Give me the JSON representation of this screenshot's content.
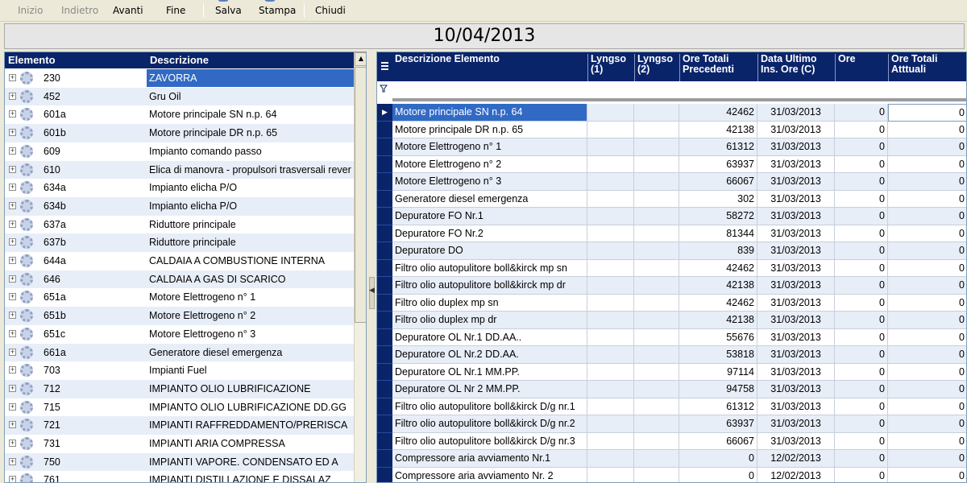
{
  "toolbar": {
    "items": [
      {
        "label": "Inizio",
        "enabled": false
      },
      {
        "label": "Indietro",
        "enabled": false
      },
      {
        "label": "Avanti",
        "enabled": true
      },
      {
        "label": "Fine",
        "enabled": true
      },
      {
        "label": "Salva",
        "enabled": true
      },
      {
        "label": "Stampa",
        "enabled": true
      },
      {
        "label": "Chiudi",
        "enabled": true
      }
    ]
  },
  "date_display": "10/04/2013",
  "left_grid": {
    "columns": [
      "Elemento",
      "Descrizione"
    ],
    "selected_index": 0,
    "rows": [
      {
        "code": "230",
        "desc": "ZAVORRA"
      },
      {
        "code": "452",
        "desc": "Gru Oil"
      },
      {
        "code": "601a",
        "desc": "Motore principale SN n.p. 64"
      },
      {
        "code": "601b",
        "desc": "Motore principale DR n.p. 65"
      },
      {
        "code": "609",
        "desc": "Impianto comando passo"
      },
      {
        "code": "610",
        "desc": "Elica di manovra - propulsori trasversali rever"
      },
      {
        "code": "634a",
        "desc": "Impianto elicha P/O"
      },
      {
        "code": "634b",
        "desc": "Impianto elicha P/O"
      },
      {
        "code": "637a",
        "desc": "Riduttore principale"
      },
      {
        "code": "637b",
        "desc": "Riduttore principale"
      },
      {
        "code": "644a",
        "desc": "CALDAIA A  COMBUSTIONE  INTERNA"
      },
      {
        "code": "646",
        "desc": "CALDAIA  A  GAS   DI  SCARICO"
      },
      {
        "code": "651a",
        "desc": "Motore Elettrogeno n° 1"
      },
      {
        "code": "651b",
        "desc": "Motore Elettrogeno n° 2"
      },
      {
        "code": "651c",
        "desc": "Motore Elettrogeno n° 3"
      },
      {
        "code": "661a",
        "desc": "Generatore diesel emergenza"
      },
      {
        "code": "703",
        "desc": "Impianti Fuel"
      },
      {
        "code": "712",
        "desc": "IMPIANTO OLIO LUBRIFICAZIONE"
      },
      {
        "code": "715",
        "desc": "IMPIANTO OLIO LUBRIFICAZIONE DD.GG"
      },
      {
        "code": "721",
        "desc": "IMPIANTI RAFFREDDAMENTO/PRERISCA"
      },
      {
        "code": "731",
        "desc": "IMPIANTI ARIA COMPRESSA"
      },
      {
        "code": "750",
        "desc": "IMPIANTI  VAPORE. CONDENSATO ED  A"
      },
      {
        "code": "761",
        "desc": "IMPIANTI   DISTILLAZIONE  E  DISSALAZ"
      }
    ]
  },
  "right_grid": {
    "columns": {
      "desc": "Descrizione Elemento",
      "lyngso1": "Lyngso (1)",
      "lyngso2": "Lyngso (2)",
      "ore_prec": "Ore Totali Precedenti",
      "data_ultimo": "Data Ultimo Ins. Ore (C)",
      "ore": "Ore",
      "ore_att": "Ore Totali Atttuali"
    },
    "selected_index": 0,
    "rows": [
      {
        "desc": "Motore principale SN n.p. 64",
        "ore_prec": "42462",
        "data": "31/03/2013",
        "ore": "0",
        "ore_att": "0"
      },
      {
        "desc": "Motore principale DR n.p. 65",
        "ore_prec": "42138",
        "data": "31/03/2013",
        "ore": "0",
        "ore_att": "0"
      },
      {
        "desc": "Motore Elettrogeno n° 1",
        "ore_prec": "61312",
        "data": "31/03/2013",
        "ore": "0",
        "ore_att": "0"
      },
      {
        "desc": "Motore Elettrogeno n° 2",
        "ore_prec": "63937",
        "data": "31/03/2013",
        "ore": "0",
        "ore_att": "0"
      },
      {
        "desc": "Motore Elettrogeno n° 3",
        "ore_prec": "66067",
        "data": "31/03/2013",
        "ore": "0",
        "ore_att": "0"
      },
      {
        "desc": "Generatore diesel emergenza",
        "ore_prec": "302",
        "data": "31/03/2013",
        "ore": "0",
        "ore_att": "0"
      },
      {
        "desc": "Depuratore FO Nr.1",
        "ore_prec": "58272",
        "data": "31/03/2013",
        "ore": "0",
        "ore_att": "0"
      },
      {
        "desc": "Depuratore FO Nr.2",
        "ore_prec": "81344",
        "data": "31/03/2013",
        "ore": "0",
        "ore_att": "0"
      },
      {
        "desc": "Depuratore DO",
        "ore_prec": "839",
        "data": "31/03/2013",
        "ore": "0",
        "ore_att": "0"
      },
      {
        "desc": "Filtro olio autopulitore boll&kirck  mp  sn",
        "ore_prec": "42462",
        "data": "31/03/2013",
        "ore": "0",
        "ore_att": "0"
      },
      {
        "desc": "Filtro olio autopulitore boll&kirck  mp  dr",
        "ore_prec": "42138",
        "data": "31/03/2013",
        "ore": "0",
        "ore_att": "0"
      },
      {
        "desc": "Filtro olio duplex  mp sn",
        "ore_prec": "42462",
        "data": "31/03/2013",
        "ore": "0",
        "ore_att": "0"
      },
      {
        "desc": "Filtro olio duplex  mp dr",
        "ore_prec": "42138",
        "data": "31/03/2013",
        "ore": "0",
        "ore_att": "0"
      },
      {
        "desc": "Depuratore OL Nr.1 DD.AA..",
        "ore_prec": "55676",
        "data": "31/03/2013",
        "ore": "0",
        "ore_att": "0"
      },
      {
        "desc": "Depuratore OL Nr.2 DD.AA.",
        "ore_prec": "53818",
        "data": "31/03/2013",
        "ore": "0",
        "ore_att": "0"
      },
      {
        "desc": "Depuratore OL Nr.1  MM.PP.",
        "ore_prec": "97114",
        "data": "31/03/2013",
        "ore": "0",
        "ore_att": "0"
      },
      {
        "desc": "Depuratore OL Nr 2 MM.PP.",
        "ore_prec": "94758",
        "data": "31/03/2013",
        "ore": "0",
        "ore_att": "0"
      },
      {
        "desc": "Filtro olio autopulitore boll&kirck  D/g nr.1",
        "ore_prec": "61312",
        "data": "31/03/2013",
        "ore": "0",
        "ore_att": "0"
      },
      {
        "desc": "Filtro olio autopulitore boll&kirck  D/g nr.2",
        "ore_prec": "63937",
        "data": "31/03/2013",
        "ore": "0",
        "ore_att": "0"
      },
      {
        "desc": "Filtro olio autopulitore boll&kirck  D/g nr.3",
        "ore_prec": "66067",
        "data": "31/03/2013",
        "ore": "0",
        "ore_att": "0"
      },
      {
        "desc": "Compressore aria  avviamento Nr.1",
        "ore_prec": "0",
        "data": "12/02/2013",
        "ore": "0",
        "ore_att": "0"
      },
      {
        "desc": "Compressore aria  avviamento Nr. 2",
        "ore_prec": "0",
        "data": "12/02/2013",
        "ore": "0",
        "ore_att": "0"
      }
    ]
  },
  "colors": {
    "header_bg": "#0a246a",
    "selection": "#316ac5",
    "alt_row": "#e8eef7",
    "window_bg": "#ece9d8"
  },
  "icons": [
    "expand-plus-icon",
    "gear-icon",
    "grid-menu-icon",
    "filter-icon",
    "row-pointer-icon",
    "scroll-up-icon",
    "splitter-left-arrow-icon"
  ]
}
